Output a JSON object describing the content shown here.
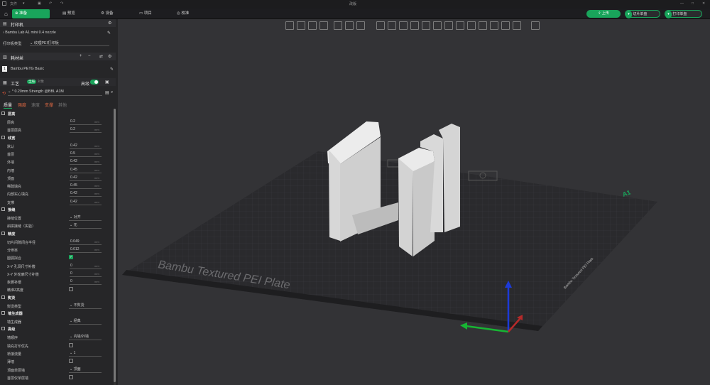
{
  "titlebar": {
    "file_menu": "文件",
    "doc_title": "改版"
  },
  "tabs": {
    "home": "",
    "prepare": "准备",
    "preview": "预览",
    "device": "设备",
    "project": "项目",
    "calibration": "校准"
  },
  "actions": {
    "upload": "上传",
    "slice_plate": "切片单盘",
    "print_plate": "打印单盘"
  },
  "printer": {
    "section": "打印机",
    "name": "Bambu Lab A1 mini 0.4 nozzle",
    "plate_label": "打印板类型",
    "plate_value": "纹理PEI打印板"
  },
  "filament": {
    "section": "耗材丝",
    "index": "1",
    "name": "Bambu PETG Basic"
  },
  "process": {
    "section": "工艺",
    "global": "全局",
    "object": "对象",
    "advanced": "高级",
    "preset": "* 0.20mm Strength @BBL A1M"
  },
  "subtabs": [
    "质量",
    "强度",
    "速度",
    "支撑",
    "其他"
  ],
  "groups": [
    {
      "title": "层高",
      "rows": [
        {
          "label": "层高",
          "value": "0.2",
          "unit": "mm"
        },
        {
          "label": "首层层高",
          "value": "0.2",
          "unit": "mm"
        }
      ]
    },
    {
      "title": "线宽",
      "rows": [
        {
          "label": "默认",
          "value": "0.42",
          "unit": "mm"
        },
        {
          "label": "首层",
          "value": "0.5",
          "unit": "mm"
        },
        {
          "label": "外墙",
          "value": "0.42",
          "unit": "mm"
        },
        {
          "label": "内墙",
          "value": "0.45",
          "unit": "mm"
        },
        {
          "label": "顶面",
          "value": "0.42",
          "unit": "mm"
        },
        {
          "label": "稀疏填充",
          "value": "0.45",
          "unit": "mm"
        },
        {
          "label": "内部实心填充",
          "value": "0.42",
          "unit": "mm"
        },
        {
          "label": "支撑",
          "value": "0.42",
          "unit": "mm"
        }
      ]
    },
    {
      "title": "接缝",
      "rows": [
        {
          "label": "接缝位置",
          "value": "对齐"
        },
        {
          "label": "斜拼接缝（实验）",
          "value": "无"
        }
      ]
    },
    {
      "title": "精度",
      "rows": [
        {
          "label": "切片间隙闭合半径",
          "value": "0.049",
          "unit": "mm"
        },
        {
          "label": "分辨率",
          "value": "0.012",
          "unit": "mm"
        },
        {
          "label": "圆弧拟合",
          "checkbox": true,
          "checked": true
        },
        {
          "label": "X-Y 孔洞尺寸补偿",
          "value": "0",
          "unit": "mm"
        },
        {
          "label": "X-Y 外轮廓尺寸补偿",
          "value": "0",
          "unit": "mm"
        },
        {
          "label": "象脚补偿",
          "value": "0",
          "unit": "mm"
        },
        {
          "label": "精准Z高度",
          "checkbox": true,
          "checked": false
        }
      ]
    },
    {
      "title": "熨烫",
      "rows": [
        {
          "label": "熨烫类型",
          "value": "不熨烫"
        }
      ]
    },
    {
      "title": "墙生成器",
      "rows": [
        {
          "label": "墙生成器",
          "value": "经典"
        }
      ]
    },
    {
      "title": "高级",
      "rows": [
        {
          "label": "墙顺序",
          "value": "内墙/外墙"
        },
        {
          "label": "填充打印优先",
          "checkbox": true,
          "checked": false
        },
        {
          "label": "桥接流量",
          "value": "1"
        },
        {
          "label": "薄墙",
          "checkbox": true,
          "checked": false
        },
        {
          "label": "顶面单层墙",
          "value": "顶面"
        },
        {
          "label": "首层仅单层墙",
          "checkbox": true,
          "checked": false
        }
      ]
    }
  ],
  "plate": {
    "label": "Bambu Textured PEI Plate",
    "side_label": "Bambu Textured PEI Plate",
    "marker": "A1"
  },
  "colors": {
    "accent": "#19a55b",
    "plate": "#2a2a2d",
    "model": "#e6e6e6"
  }
}
